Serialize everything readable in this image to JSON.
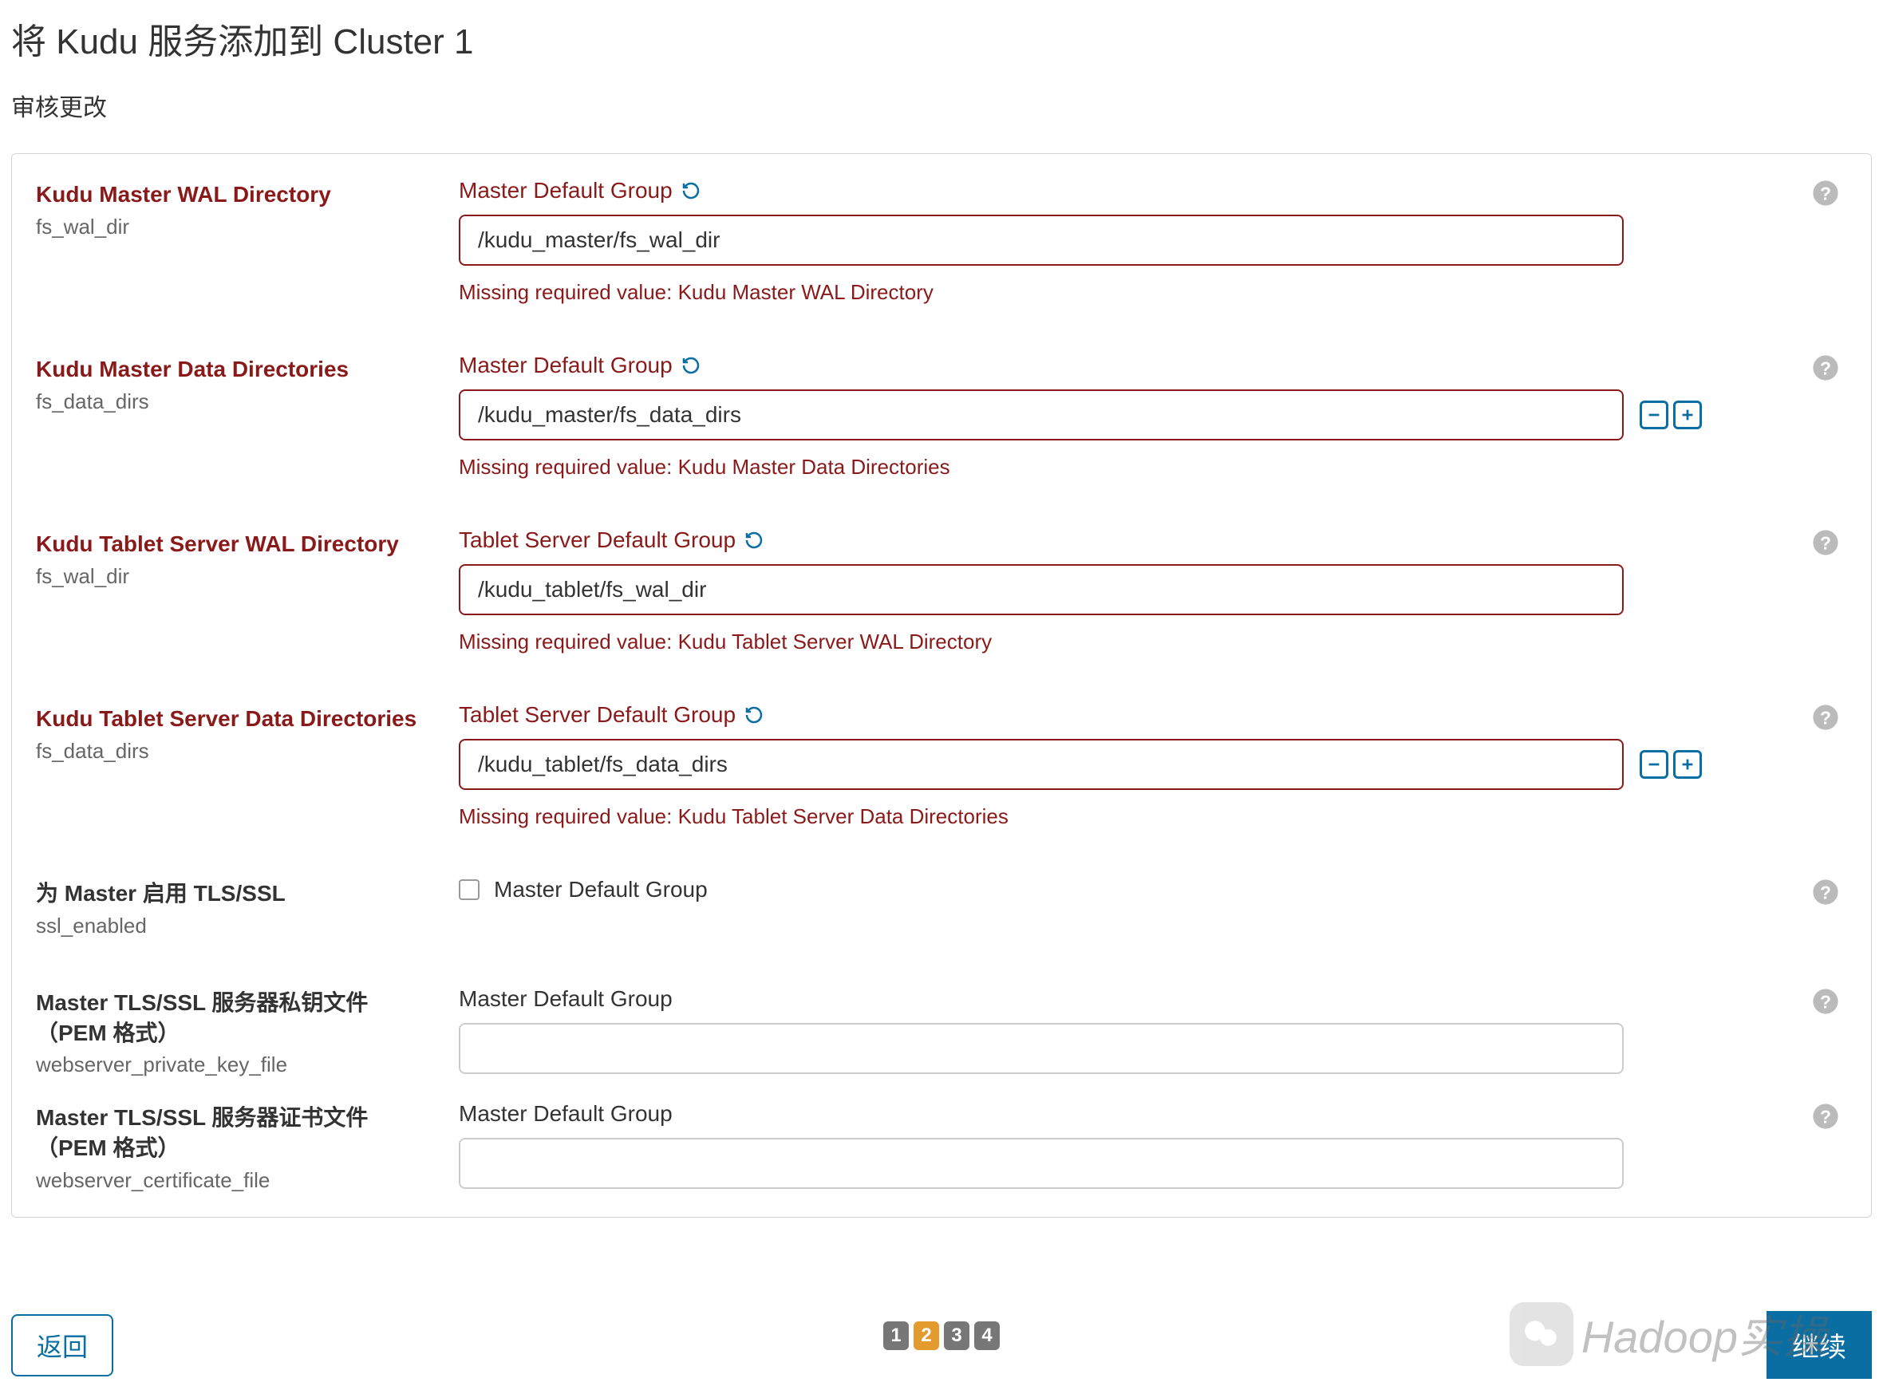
{
  "page": {
    "title": "将 Kudu 服务添加到 Cluster 1",
    "subtitle": "审核更改"
  },
  "config": [
    {
      "label": "Kudu Master WAL Directory",
      "key": "fs_wal_dir",
      "required": true,
      "group": "Master Default Group",
      "group_reset": true,
      "value": "/kudu_master/fs_wal_dir",
      "error": "Missing required value: Kudu Master WAL Directory",
      "has_plusminus": false
    },
    {
      "label": "Kudu Master Data Directories",
      "key": "fs_data_dirs",
      "required": true,
      "group": "Master Default Group",
      "group_reset": true,
      "value": "/kudu_master/fs_data_dirs",
      "error": "Missing required value: Kudu Master Data Directories",
      "has_plusminus": true
    },
    {
      "label": "Kudu Tablet Server WAL Directory",
      "key": "fs_wal_dir",
      "required": true,
      "group": "Tablet Server Default Group",
      "group_reset": true,
      "value": "/kudu_tablet/fs_wal_dir",
      "error": "Missing required value: Kudu Tablet Server WAL Directory",
      "has_plusminus": false
    },
    {
      "label": "Kudu Tablet Server Data Directories",
      "key": "fs_data_dirs",
      "required": true,
      "group": "Tablet Server Default Group",
      "group_reset": true,
      "value": "/kudu_tablet/fs_data_dirs",
      "error": "Missing required value: Kudu Tablet Server Data Directories",
      "has_plusminus": true
    },
    {
      "label": "为 Master 启用 TLS/SSL",
      "key": "ssl_enabled",
      "required": false,
      "group": "Master Default Group",
      "type": "checkbox",
      "checked": false
    },
    {
      "label": "Master TLS/SSL 服务器私钥文件（PEM 格式）",
      "key": "webserver_private_key_file",
      "required": false,
      "group": "Master Default Group",
      "value": ""
    },
    {
      "label": "Master TLS/SSL 服务器证书文件（PEM 格式）",
      "key": "webserver_certificate_file",
      "required": false,
      "group": "Master Default Group",
      "value": ""
    }
  ],
  "footer": {
    "back": "返回",
    "continue": "继续",
    "pages": [
      "1",
      "2",
      "3",
      "4"
    ],
    "active_page": 1
  },
  "watermark": "Hadoop实操"
}
